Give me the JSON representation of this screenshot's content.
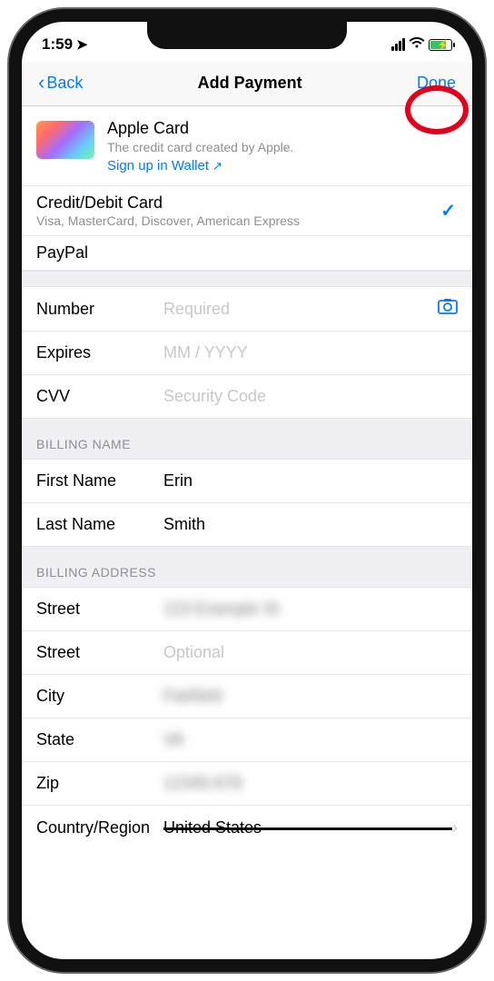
{
  "status": {
    "time": "1:59"
  },
  "nav": {
    "back": "Back",
    "title": "Add Payment",
    "done": "Done"
  },
  "appleCard": {
    "title": "Apple Card",
    "subtitle": "The credit card created by Apple.",
    "link": "Sign up in Wallet"
  },
  "paymentOptions": {
    "creditDebit": {
      "title": "Credit/Debit Card",
      "sub": "Visa, MasterCard, Discover, American Express"
    },
    "paypal": {
      "title": "PayPal"
    }
  },
  "cardFields": {
    "numberLabel": "Number",
    "numberPlaceholder": "Required",
    "expiresLabel": "Expires",
    "expiresPlaceholder": "MM  / YYYY",
    "cvvLabel": "CVV",
    "cvvPlaceholder": "Security Code"
  },
  "billingName": {
    "header": "BILLING NAME",
    "firstLabel": "First Name",
    "firstValue": "Erin",
    "lastLabel": "Last Name",
    "lastValue": "Smith"
  },
  "billingAddress": {
    "header": "BILLING ADDRESS",
    "streetLabel": "Street",
    "streetValue": "123 Example St",
    "street2Label": "Street",
    "street2Placeholder": "Optional",
    "cityLabel": "City",
    "cityValue": "Fairfield",
    "stateLabel": "State",
    "stateValue": "VA",
    "zipLabel": "Zip",
    "zipValue": "12345-678",
    "countryLabel": "Country/Region",
    "countryValue": "United States"
  }
}
